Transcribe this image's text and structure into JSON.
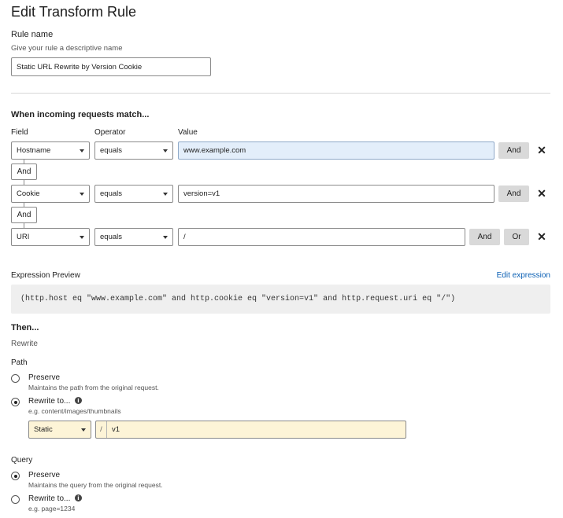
{
  "page": {
    "title": "Edit Transform Rule"
  },
  "rule_name": {
    "label": "Rule name",
    "help": "Give your rule a descriptive name",
    "value": "Static URL Rewrite by Version Cookie"
  },
  "match": {
    "heading": "When incoming requests match...",
    "col_field": "Field",
    "col_operator": "Operator",
    "col_value": "Value",
    "rows": [
      {
        "field": "Hostname",
        "operator": "equals",
        "value": "www.example.com",
        "and_label": "And"
      },
      {
        "field": "Cookie",
        "operator": "equals",
        "value": "version=v1",
        "and_label": "And"
      },
      {
        "field": "URI",
        "operator": "equals",
        "value": "/",
        "and_label": "And",
        "or_label": "Or"
      }
    ],
    "connectors": [
      "And",
      "And"
    ]
  },
  "expression": {
    "label": "Expression Preview",
    "edit_link": "Edit expression",
    "code": "(http.host eq \"www.example.com\" and http.cookie eq \"version=v1\" and http.request.uri eq \"/\")"
  },
  "then": {
    "heading": "Then...",
    "action": "Rewrite",
    "path": {
      "label": "Path",
      "preserve_label": "Preserve",
      "preserve_help": "Maintains the path from the original request.",
      "rewrite_label": "Rewrite to...",
      "rewrite_help": "e.g. content/images/thumbnails",
      "type_value": "Static",
      "prefix": "/",
      "value": "v1",
      "selected": "rewrite"
    },
    "query": {
      "label": "Query",
      "preserve_label": "Preserve",
      "preserve_help": "Maintains the query from the original request.",
      "rewrite_label": "Rewrite to...",
      "rewrite_help": "e.g. page=1234",
      "selected": "preserve"
    }
  },
  "icons": {
    "close": "close-icon",
    "info": "info-icon",
    "caret": "chevron-down-icon"
  },
  "colors": {
    "highlight_input": "#e3eefa",
    "rewrite_input": "#fdf4d7",
    "link": "#0a5fb4"
  }
}
